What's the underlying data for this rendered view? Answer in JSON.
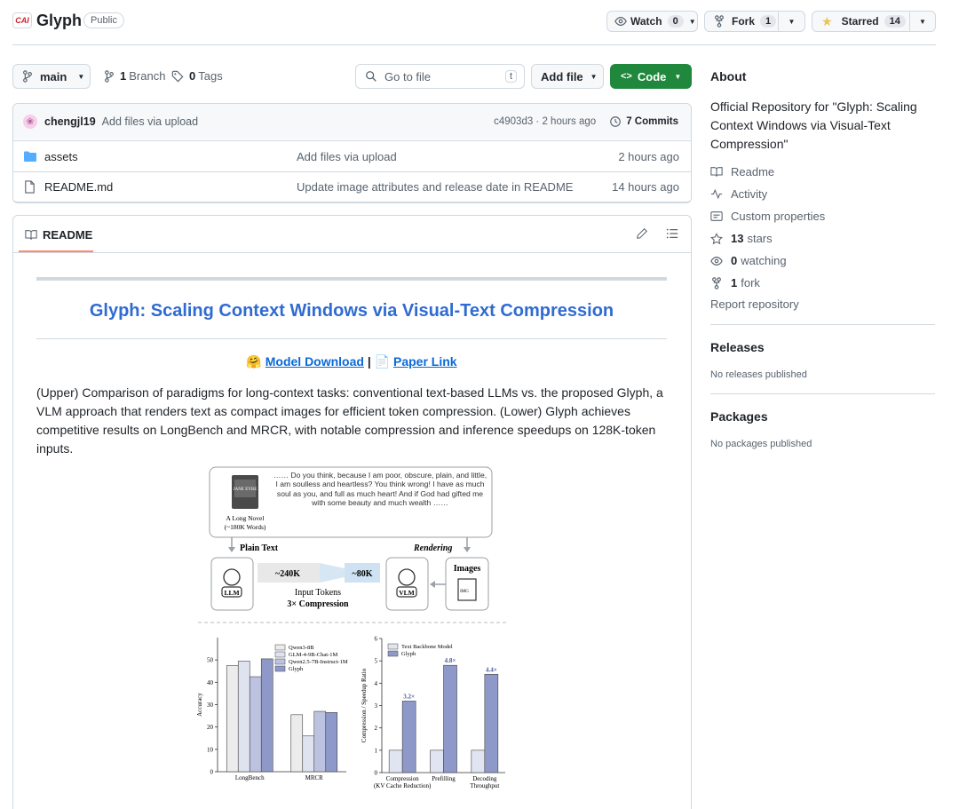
{
  "header": {
    "owner_logo": "CAI",
    "repo_name": "Glyph",
    "visibility": "Public",
    "watch": {
      "label": "Watch",
      "count": "0"
    },
    "fork": {
      "label": "Fork",
      "count": "1"
    },
    "star": {
      "label": "Starred",
      "count": "14"
    }
  },
  "toolbar": {
    "branch": "main",
    "branches_count": "1",
    "branches_label": "Branch",
    "tags_count": "0",
    "tags_label": "Tags",
    "search_placeholder": "Go to file",
    "search_shortcut": "t",
    "add_file": "Add file",
    "code": "Code"
  },
  "commit": {
    "author": "chengjl19",
    "message": "Add files via upload",
    "hash_time": "c4903d3 · 2 hours ago",
    "commits": "7 Commits"
  },
  "files": [
    {
      "name": "assets",
      "type": "folder",
      "message": "Add files via upload",
      "time": "2 hours ago"
    },
    {
      "name": "README.md",
      "type": "file",
      "message": "Update image attributes and release date in README",
      "time": "14 hours ago"
    }
  ],
  "readme": {
    "tab_label": "README",
    "title": "Glyph: Scaling Context Windows via Visual-Text Compression",
    "link_model_emoji": "🤗",
    "link_model": "Model Download",
    "link_sep": "|",
    "link_paper_emoji": "📄",
    "link_paper": "Paper Link",
    "description": "(Upper) Comparison of paradigms for long-context tasks: conventional text-based LLMs vs. the proposed Glyph, a VLM approach that renders text as compact images for efficient token compression. (Lower) Glyph achieves competitive results on LongBench and MRCR, with notable compression and inference speedups on 128K-token inputs."
  },
  "figure": {
    "book_title": "JANE EYRE",
    "novel_label": "A Long Novel",
    "novel_words": "(~180K Words)",
    "quote": "…… Do you think, because I am poor, obscure, plain, and little, I am soulless and heartless? You think wrong! I have as much soul as you, and full as much heart! And if God had gifted me with some beauty and much wealth ……",
    "plain_text": "Plain Text",
    "rendering": "Rendering",
    "llm": "LLM",
    "vlm": "VLM",
    "images": "Images",
    "img_tag": "IMG",
    "tokens_text": "~240K",
    "tokens_vis": "~80K",
    "input_tokens": "Input Tokens",
    "compression": "3× Compression"
  },
  "chart_data": [
    {
      "type": "bar",
      "categories": [
        "LongBench",
        "MRCR"
      ],
      "series": [
        {
          "name": "Qwen3-8B",
          "values": [
            47.5,
            25.5
          ]
        },
        {
          "name": "GLM-4-9B-Chat-1M",
          "values": [
            49.5,
            16
          ]
        },
        {
          "name": "Qwen2.5-7B-Instruct-1M",
          "values": [
            42.5,
            27
          ]
        },
        {
          "name": "Glyph",
          "values": [
            50.5,
            26.5
          ]
        }
      ],
      "ylabel": "Accuracy",
      "ylim": [
        0,
        60
      ],
      "yticks": [
        "0",
        "10",
        "20",
        "30",
        "40",
        "50"
      ],
      "legend": "top-right",
      "colors": [
        "#ececec",
        "#dfe2ef",
        "#bcc3e0",
        "#8e99c9"
      ]
    },
    {
      "type": "bar",
      "categories": [
        "Compression",
        "Prefilling",
        "Decoding"
      ],
      "category_sublabels": [
        "(KV Cache Reduction)",
        "",
        "Throughput"
      ],
      "series": [
        {
          "name": "Text Backbone Model",
          "values": [
            1,
            1,
            1
          ]
        },
        {
          "name": "Glyph",
          "values": [
            3.2,
            4.8,
            4.4
          ]
        }
      ],
      "annotations": [
        "3.2×",
        "4.8×",
        "4.4×"
      ],
      "ylabel": "Compression / Speedup Ratio",
      "ylim": [
        0,
        6
      ],
      "yticks": [
        "0",
        "1",
        "2",
        "3",
        "4",
        "5",
        "6"
      ],
      "legend": "top-left",
      "colors": [
        "#e1e4f1",
        "#8e99c9"
      ]
    }
  ],
  "about": {
    "heading": "About",
    "description": "Official Repository for \"Glyph: Scaling Context Windows via Visual-Text Compression\"",
    "readme": "Readme",
    "activity": "Activity",
    "custom_properties": "Custom properties",
    "stars_count": "13",
    "stars_label": "stars",
    "watching_count": "0",
    "watching_label": "watching",
    "forks_count": "1",
    "forks_label": "fork",
    "report": "Report repository"
  },
  "releases": {
    "heading": "Releases",
    "empty": "No releases published"
  },
  "packages": {
    "heading": "Packages",
    "empty": "No packages published"
  }
}
